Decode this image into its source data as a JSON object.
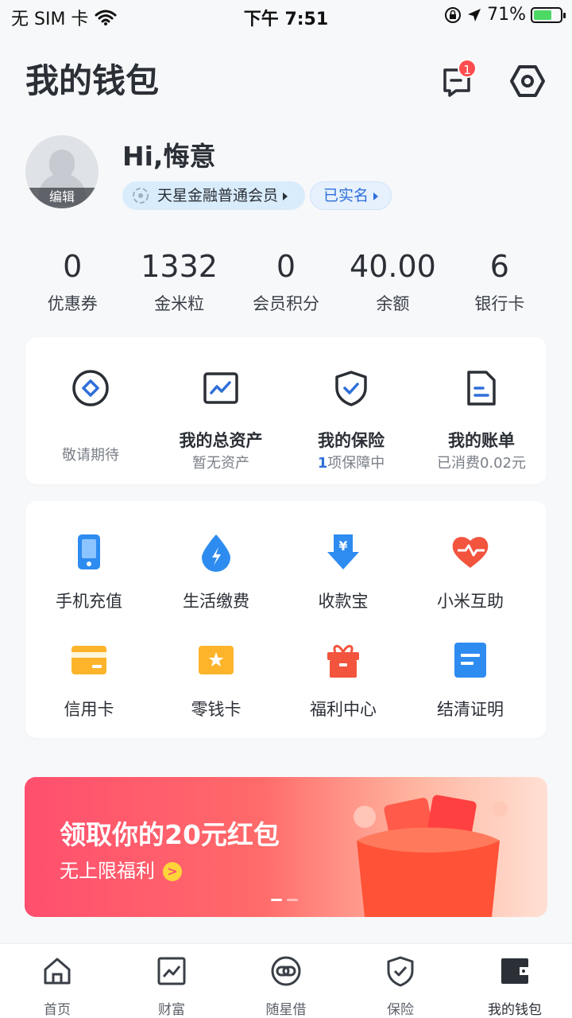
{
  "status_bar": {
    "carrier": "无 SIM 卡",
    "time": "下午 7:51",
    "battery": "71%"
  },
  "header": {
    "title": "我的钱包",
    "message_badge": "1"
  },
  "profile": {
    "greeting": "Hi,悔意",
    "edit_label": "编辑",
    "member_tag": "天星金融普通会员",
    "verify_tag": "已实名"
  },
  "stats": [
    {
      "value": "0",
      "label": "优惠券"
    },
    {
      "value": "1332",
      "label": "金米粒"
    },
    {
      "value": "0",
      "label": "会员积分"
    },
    {
      "value": "40.00",
      "label": "余额"
    },
    {
      "value": "6",
      "label": "银行卡"
    }
  ],
  "features": [
    {
      "icon": "coming-soon-icon",
      "name": "",
      "sub": "敬请期待"
    },
    {
      "icon": "total-assets-icon",
      "name": "我的总资产",
      "sub": "暂无资产"
    },
    {
      "icon": "insurance-shield-icon",
      "name": "我的保险",
      "sub_count": "1",
      "sub": "项保障中"
    },
    {
      "icon": "bill-icon",
      "name": "我的账单",
      "sub": "已消费0.02元"
    }
  ],
  "services": [
    {
      "icon": "phone-recharge-icon",
      "name": "手机充值"
    },
    {
      "icon": "utility-bill-icon",
      "name": "生活缴费"
    },
    {
      "icon": "payment-collection-icon",
      "name": "收款宝"
    },
    {
      "icon": "mutual-aid-heart-icon",
      "name": "小米互助"
    },
    {
      "icon": "credit-card-icon",
      "name": "信用卡"
    },
    {
      "icon": "change-card-icon",
      "name": "零钱卡"
    },
    {
      "icon": "gift-box-icon",
      "name": "福利中心"
    },
    {
      "icon": "settlement-certificate-icon",
      "name": "结清证明"
    }
  ],
  "banner": {
    "title": "领取你的20元红包",
    "subtitle": "无上限福利",
    "go": ">"
  },
  "tabs": [
    {
      "icon": "home-icon",
      "name": "首页"
    },
    {
      "icon": "wealth-chart-icon",
      "name": "财富"
    },
    {
      "icon": "loan-link-icon",
      "name": "随星借"
    },
    {
      "icon": "insurance-tab-icon",
      "name": "保险"
    },
    {
      "icon": "wallet-icon",
      "name": "我的钱包"
    }
  ],
  "colors": {
    "accent": "#2f6fd9",
    "badge": "#ff4d4f",
    "text": "#2b2f36"
  }
}
